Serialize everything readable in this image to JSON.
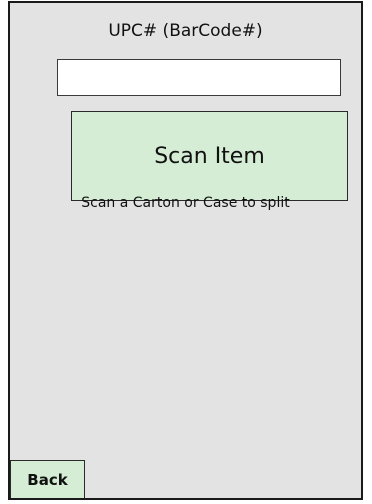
{
  "form": {
    "upc_label": "UPC# (BarCode#)",
    "upc_value": "",
    "scan_button_label": "Scan Item",
    "hint_text": "Scan a Carton or Case to split"
  },
  "footer": {
    "back_label": "Back"
  },
  "colors": {
    "background": "#e3e3e3",
    "button_fill": "#d4edd4",
    "border": "#1a1a1a"
  }
}
